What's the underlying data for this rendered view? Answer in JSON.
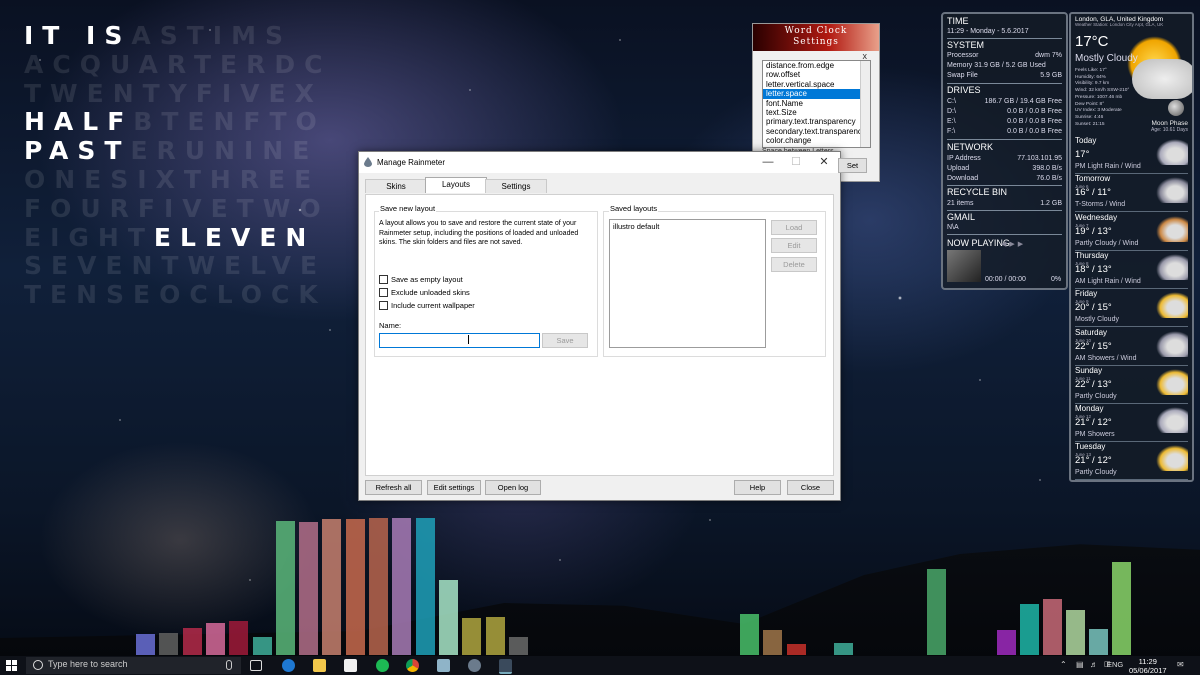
{
  "word_clock": {
    "rows": [
      {
        "on": "IT IS",
        "off": "ASTIMS"
      },
      {
        "on": "",
        "off": "ACQUARTERDC"
      },
      {
        "on": "",
        "off": "TWENTYFIVEX"
      },
      {
        "on": "HALF",
        "off": "BTENFTO"
      },
      {
        "on": "PAST",
        "off": "ERUNINE"
      },
      {
        "on": "",
        "off": "ONESIXTHREE"
      },
      {
        "on": "",
        "off": "FOURFIVETWO"
      },
      {
        "on": "",
        "off": "EIGHT"
      },
      {
        "on": "",
        "off": "SEVENTWELVE"
      },
      {
        "on": "",
        "off": "TENSEOCLOCK"
      }
    ],
    "eleven_prefix": "EIGHT",
    "eleven": "ELEVEN"
  },
  "wordclock_settings": {
    "title_line1": "Word Clock",
    "title_line2": "Settings",
    "close": "x",
    "items": [
      "distance.from.edge",
      "row.offset",
      "letter.vertical.space",
      "letter.space",
      "font.Name",
      "text.Size",
      "primary.text.transparency",
      "secondary.text.transparency",
      "color.change"
    ],
    "selected_index": 3,
    "description": "Space between Letters",
    "set_label": "Set"
  },
  "dialog": {
    "title": "Manage Rainmeter",
    "tabs": [
      "Skins",
      "Layouts",
      "Settings"
    ],
    "active_tab": 1,
    "save_group_label": "Save new layout",
    "description": "A layout allows you to save and restore the current state of your Rainmeter setup, including the positions of loaded and unloaded skins. The skin folders and files are not saved.",
    "checkboxes": [
      "Save as empty layout",
      "Exclude unloaded skins",
      "Include current wallpaper"
    ],
    "name_label": "Name:",
    "name_value": "",
    "save_button": "Save",
    "saved_group_label": "Saved layouts",
    "saved_layouts": [
      "illustro default"
    ],
    "load_button": "Load",
    "edit_button": "Edit",
    "delete_button": "Delete",
    "refresh_button": "Refresh all",
    "edit_settings_button": "Edit settings",
    "open_log_button": "Open log",
    "help_button": "Help",
    "close_button": "Close"
  },
  "system": {
    "time_h": "TIME",
    "time_v": "11:29 - Monday - 5.6.2017",
    "system_h": "SYSTEM",
    "processor_l": "Processor",
    "processor_v": "dwm 7%",
    "memory_l": "Memory 31.9 GB / 5.2 GB Used",
    "swap_l": "Swap File",
    "swap_v": "5.9 GB",
    "drives_h": "DRIVES",
    "drives": [
      {
        "l": "C:\\",
        "v": "186.7 GB / 19.4 GB Free"
      },
      {
        "l": "D:\\",
        "v": "0.0 B / 0.0 B Free"
      },
      {
        "l": "E:\\",
        "v": "0.0 B / 0.0 B Free"
      },
      {
        "l": "F:\\",
        "v": "0.0 B / 0.0 B Free"
      }
    ],
    "network_h": "NETWORK",
    "ip_l": "IP Address",
    "ip_v": "77.103.101.95",
    "up_l": "Upload",
    "up_v": "398.0 B/s",
    "down_l": "Download",
    "down_v": "76.0 B/s",
    "recycle_h": "RECYCLE BIN",
    "recycle_l": "21 items",
    "recycle_v": "1.2 GB",
    "gmail_h": "GMAIL",
    "gmail_v": "N\\A",
    "np_h": "NOW PLAYING",
    "np_time": "00:00 / 00:00",
    "np_pct": "0%"
  },
  "weather": {
    "location": "London, GLA, United Kingdom",
    "station": "Weather Station: London City Arpt, GLA, UK",
    "temp": "17°C",
    "condition": "Mostly Cloudy",
    "details": [
      "Feels Like: 17°",
      "Humidity: 64%",
      "Visibility: 9.7 km",
      "Wind: 32 km/h SSW-210°",
      "Pressure: 1007.46 mb",
      "Dew Point: 8°",
      "UV Index: 3 Moderate",
      "Sunrise: 4:46",
      "Sunset: 21:15"
    ],
    "moon_label": "Moon Phase",
    "moon_age": "Age: 10.61 Days",
    "days": [
      {
        "name": "Today",
        "date": "",
        "temp": "17°",
        "cond": "PM Light Rain / Wind"
      },
      {
        "name": "Tomorrow",
        "date": "June 6",
        "temp": "16° / 11°",
        "cond": "T-Storms / Wind"
      },
      {
        "name": "Wednesday",
        "date": "June 7",
        "temp": "19° / 13°",
        "cond": "Partly Cloudy / Wind"
      },
      {
        "name": "Thursday",
        "date": "June 8",
        "temp": "18° / 13°",
        "cond": "AM Light Rain / Wind"
      },
      {
        "name": "Friday",
        "date": "June 9",
        "temp": "20° / 15°",
        "cond": "Mostly Cloudy"
      },
      {
        "name": "Saturday",
        "date": "June 10",
        "temp": "22° / 15°",
        "cond": "AM Showers / Wind"
      },
      {
        "name": "Sunday",
        "date": "June 11",
        "temp": "22° / 13°",
        "cond": "Partly Cloudy"
      },
      {
        "name": "Monday",
        "date": "June 12",
        "temp": "21° / 12°",
        "cond": "PM Showers"
      },
      {
        "name": "Tuesday",
        "date": "June 13",
        "temp": "21° / 12°",
        "cond": "Partly Cloudy"
      }
    ]
  },
  "visualizer": {
    "left_levels": [
      0.15,
      0.16,
      0.2,
      0.23,
      0.25,
      0.13,
      0.98,
      0.97,
      0.99,
      0.99,
      1.0,
      1.0,
      1.0,
      0.55,
      0.27,
      0.28,
      0.13
    ],
    "left_colors": [
      "#6a6fd6",
      "#606060",
      "#b52a4a",
      "#d66a9a",
      "#a01a3a",
      "#3fae9a",
      "#5ab77a",
      "#b36f8a",
      "#c7806e",
      "#c86a4e",
      "#b9654e",
      "#a87bb6",
      "#1fa0b8",
      "#a8e6c8",
      "#b0a640",
      "#b0a640",
      "#6a6a6a"
    ],
    "right_levels": [
      0.3,
      0.18,
      0.08,
      0.09,
      0.63,
      0.18,
      0.37,
      0.41,
      0.33,
      0.19,
      0.68
    ],
    "right_colors": [
      "#49c06a",
      "#a0754a",
      "#c8302a",
      "#3fae9a",
      "#4aa86a",
      "#a02ac0",
      "#1fb6a8",
      "#c86a78",
      "#b0d8a0",
      "#7ac6c0",
      "#8ad66a"
    ]
  },
  "taskbar": {
    "search_placeholder": "Type here to search",
    "language": "ENG",
    "time": "11:29",
    "date": "05/06/2017"
  }
}
